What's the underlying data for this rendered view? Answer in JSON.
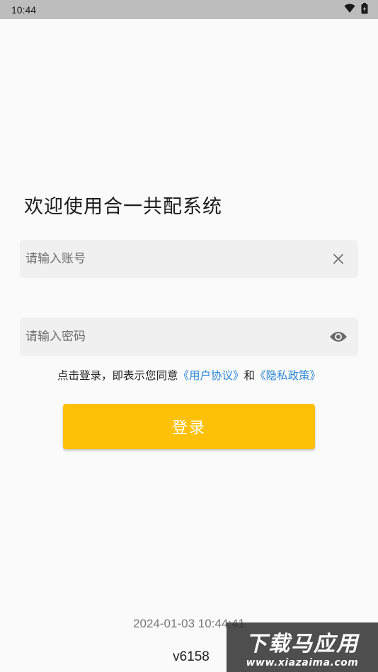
{
  "status_bar": {
    "time": "10:44",
    "icons": [
      "wifi-icon",
      "battery-icon"
    ]
  },
  "app": {
    "title": "欢迎使用合一共配系统"
  },
  "account_field": {
    "value": "",
    "placeholder": "请输入账号",
    "action_icon": "clear-icon"
  },
  "password_field": {
    "value": "",
    "placeholder": "请输入密码",
    "action_icon": "eye-icon"
  },
  "agreement": {
    "prefix": "点击登录，即表示您同意",
    "user_agreement": "《用户协议》",
    "conjunction": "和",
    "privacy_policy": "《隐私政策》"
  },
  "login": {
    "label": "登录"
  },
  "footer": {
    "build_time": "2024-01-03 10:44:41",
    "version": "v6158"
  },
  "watermark": {
    "title": "下载马应用",
    "url": "www.xiazaima.com"
  },
  "colors": {
    "accent": "#ffc107",
    "link": "#2a86d6",
    "field_bg": "#f0f0f0",
    "page_bg": "#fafafa",
    "status_bar": "#bdbdbd"
  }
}
